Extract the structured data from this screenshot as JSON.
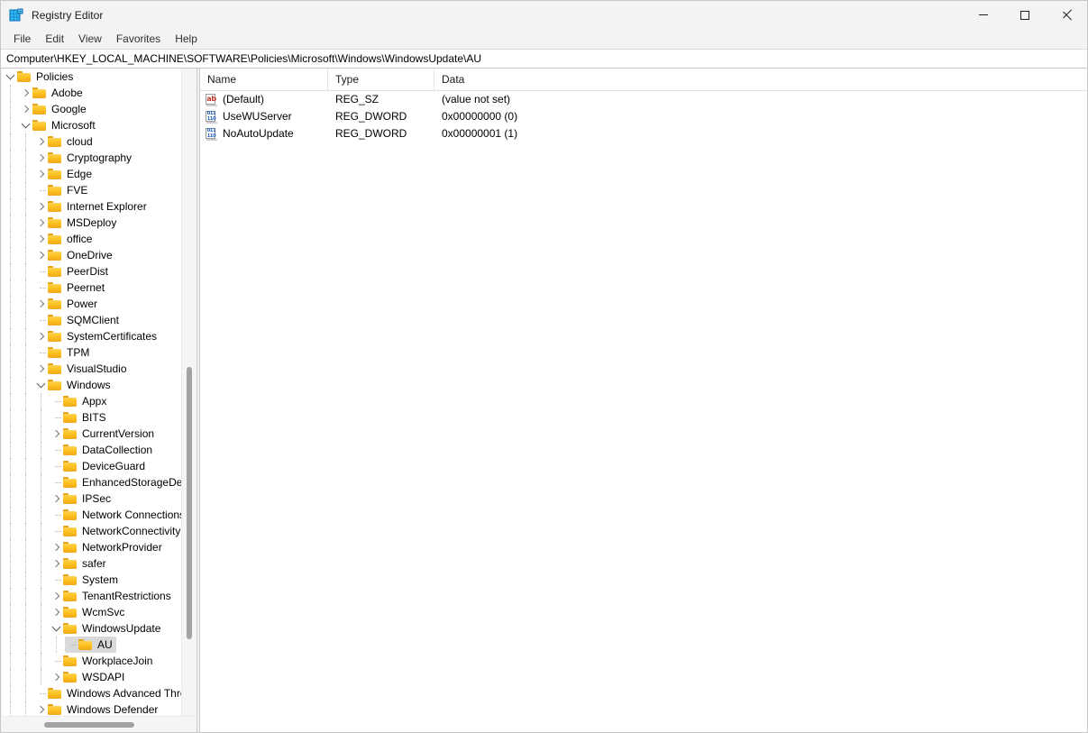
{
  "window": {
    "title": "Registry Editor",
    "app_icon": "registry-editor-icon",
    "controls": {
      "minimize": "minimize-icon",
      "maximize": "maximize-icon",
      "close": "close-icon"
    }
  },
  "menubar": {
    "items": [
      {
        "label": "File"
      },
      {
        "label": "Edit"
      },
      {
        "label": "View"
      },
      {
        "label": "Favorites"
      },
      {
        "label": "Help"
      }
    ]
  },
  "address": {
    "path": "Computer\\HKEY_LOCAL_MACHINE\\SOFTWARE\\Policies\\Microsoft\\Windows\\WindowsUpdate\\AU"
  },
  "tree": {
    "nodes": [
      {
        "label": "Policies",
        "depth": 0,
        "state": "expanded"
      },
      {
        "label": "Adobe",
        "depth": 1,
        "state": "collapsed"
      },
      {
        "label": "Google",
        "depth": 1,
        "state": "collapsed"
      },
      {
        "label": "Microsoft",
        "depth": 1,
        "state": "expanded"
      },
      {
        "label": "cloud",
        "depth": 2,
        "state": "collapsed"
      },
      {
        "label": "Cryptography",
        "depth": 2,
        "state": "collapsed"
      },
      {
        "label": "Edge",
        "depth": 2,
        "state": "collapsed"
      },
      {
        "label": "FVE",
        "depth": 2,
        "state": "leaf"
      },
      {
        "label": "Internet Explorer",
        "depth": 2,
        "state": "collapsed"
      },
      {
        "label": "MSDeploy",
        "depth": 2,
        "state": "collapsed"
      },
      {
        "label": "office",
        "depth": 2,
        "state": "collapsed"
      },
      {
        "label": "OneDrive",
        "depth": 2,
        "state": "collapsed"
      },
      {
        "label": "PeerDist",
        "depth": 2,
        "state": "leaf"
      },
      {
        "label": "Peernet",
        "depth": 2,
        "state": "leaf"
      },
      {
        "label": "Power",
        "depth": 2,
        "state": "collapsed"
      },
      {
        "label": "SQMClient",
        "depth": 2,
        "state": "leaf"
      },
      {
        "label": "SystemCertificates",
        "depth": 2,
        "state": "collapsed"
      },
      {
        "label": "TPM",
        "depth": 2,
        "state": "leaf"
      },
      {
        "label": "VisualStudio",
        "depth": 2,
        "state": "collapsed"
      },
      {
        "label": "Windows",
        "depth": 2,
        "state": "expanded"
      },
      {
        "label": "Appx",
        "depth": 3,
        "state": "leaf"
      },
      {
        "label": "BITS",
        "depth": 3,
        "state": "leaf"
      },
      {
        "label": "CurrentVersion",
        "depth": 3,
        "state": "collapsed"
      },
      {
        "label": "DataCollection",
        "depth": 3,
        "state": "leaf"
      },
      {
        "label": "DeviceGuard",
        "depth": 3,
        "state": "leaf"
      },
      {
        "label": "EnhancedStorageDevices",
        "depth": 3,
        "state": "leaf"
      },
      {
        "label": "IPSec",
        "depth": 3,
        "state": "collapsed"
      },
      {
        "label": "Network Connections",
        "depth": 3,
        "state": "leaf"
      },
      {
        "label": "NetworkConnectivityStatusIndicator",
        "depth": 3,
        "state": "leaf"
      },
      {
        "label": "NetworkProvider",
        "depth": 3,
        "state": "collapsed"
      },
      {
        "label": "safer",
        "depth": 3,
        "state": "collapsed"
      },
      {
        "label": "System",
        "depth": 3,
        "state": "leaf"
      },
      {
        "label": "TenantRestrictions",
        "depth": 3,
        "state": "collapsed"
      },
      {
        "label": "WcmSvc",
        "depth": 3,
        "state": "collapsed"
      },
      {
        "label": "WindowsUpdate",
        "depth": 3,
        "state": "expanded"
      },
      {
        "label": "AU",
        "depth": 4,
        "state": "leaf",
        "selected": true
      },
      {
        "label": "WorkplaceJoin",
        "depth": 3,
        "state": "leaf"
      },
      {
        "label": "WSDAPI",
        "depth": 3,
        "state": "collapsed"
      },
      {
        "label": "Windows Advanced Threat Protection",
        "depth": 2,
        "state": "leaf"
      },
      {
        "label": "Windows Defender",
        "depth": 2,
        "state": "collapsed"
      }
    ]
  },
  "list": {
    "columns": [
      {
        "label": "Name"
      },
      {
        "label": "Type"
      },
      {
        "label": "Data"
      }
    ],
    "rows": [
      {
        "icon": "string-value-icon",
        "icon_glyph": "ab",
        "kind": "string",
        "name": "(Default)",
        "type": "REG_SZ",
        "data": "(value not set)"
      },
      {
        "icon": "dword-value-icon",
        "icon_glyph": "011\n110",
        "kind": "dword",
        "name": "UseWUServer",
        "type": "REG_DWORD",
        "data": "0x00000000 (0)"
      },
      {
        "icon": "dword-value-icon",
        "icon_glyph": "011\n110",
        "kind": "dword",
        "name": "NoAutoUpdate",
        "type": "REG_DWORD",
        "data": "0x00000001 (1)"
      }
    ]
  },
  "scrollbars": {
    "tree_vertical": {
      "thumb_top_pct": 46,
      "thumb_height_pct": 42
    },
    "tree_horizontal": {
      "thumb_left_pct": 22,
      "thumb_width_pct": 46
    }
  },
  "colors": {
    "folder": "#fcc221",
    "selection": "#d9d9d9",
    "string_icon": "#c0392b",
    "dword_icon": "#1f5fbf",
    "window_bg": "#f3f3f3"
  }
}
